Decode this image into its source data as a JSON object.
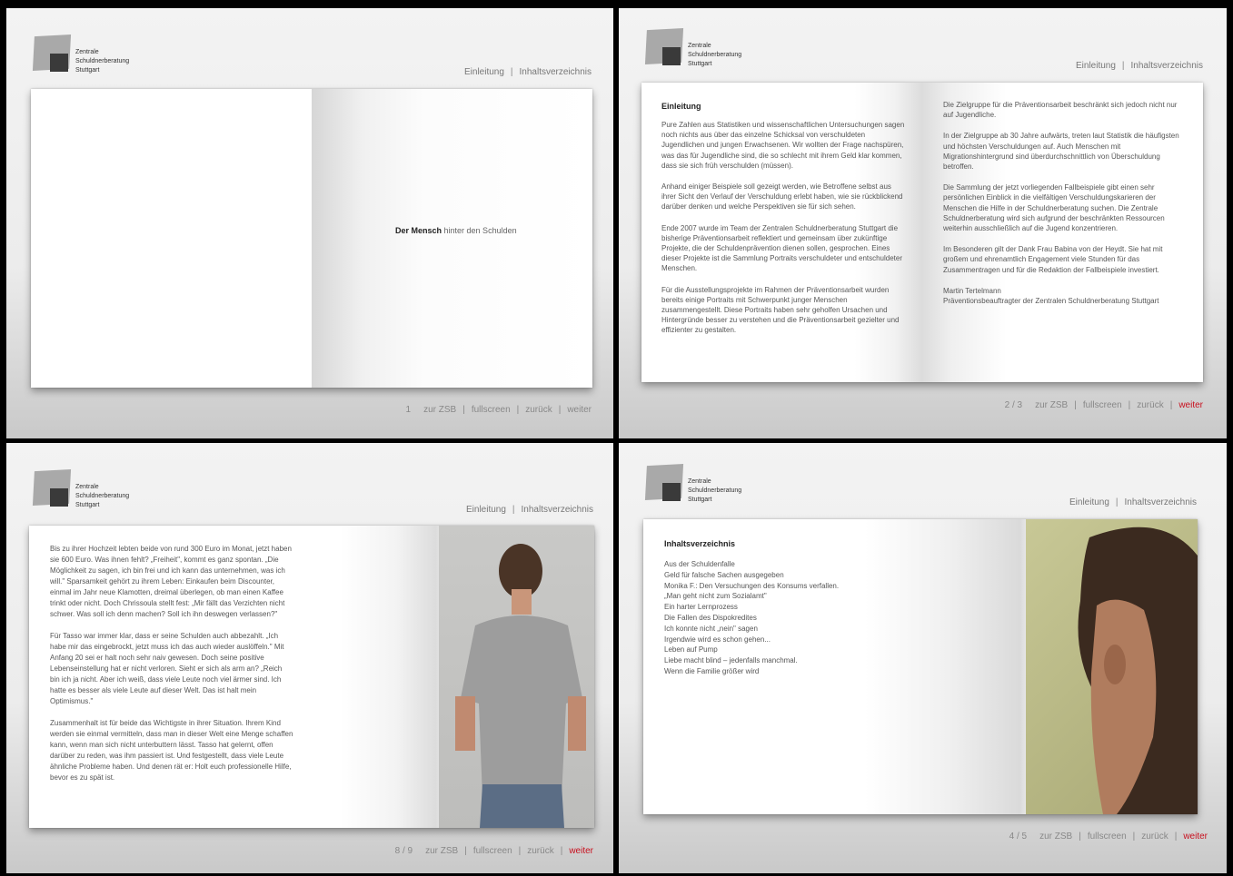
{
  "logo": {
    "text": "Zentrale\nSchuldnerberatung\nStuttgart"
  },
  "nav": {
    "intro": "Einleitung",
    "toc": "Inhaltsverzeichnis",
    "zsb": "zur ZSB",
    "fullscreen": "fullscreen",
    "back": "zurück",
    "next": "weiter"
  },
  "accent_color": "#c8101e",
  "panel1": {
    "page": "1",
    "title_bold": "Der Mensch",
    "title_rest": " hinter den Schulden"
  },
  "panel2": {
    "page": "2 / 3",
    "heading": "Einleitung",
    "left_paragraphs": [
      "Pure Zahlen aus Statistiken und wissenschaftlichen Untersuchungen sagen noch nichts aus über das einzelne Schicksal von verschuldeten Jugendlichen und jungen Erwachsenen. Wir wollten der Frage nachspüren, was das für Jugendliche sind, die so schlecht mit ihrem Geld klar kommen, dass sie sich früh verschulden (müssen).",
      "Anhand einiger Beispiele soll gezeigt werden, wie Betroffene selbst aus ihrer Sicht den Verlauf der Verschuldung erlebt haben, wie sie rückblickend darüber denken und welche Perspektiven sie für sich sehen.",
      "Ende 2007 wurde im Team der Zentralen Schuldnerberatung Stuttgart die bisherige Präventionsarbeit reflektiert und gemeinsam über zukünftige Projekte, die der Schuldenprävention dienen sollen, gesprochen. Eines dieser Projekte ist die Sammlung Portraits verschuldeter und entschuldeter Menschen.",
      "Für die Ausstellungsprojekte im Rahmen der Präventionsarbeit wurden bereits einige Portraits mit Schwerpunkt junger Menschen zusammengestellt. Diese Portraits haben sehr geholfen Ursachen und Hintergründe besser zu verstehen und die Präventionsarbeit gezielter und effizienter zu gestalten."
    ],
    "right_paragraphs": [
      "Die Zielgruppe für die Präventionsarbeit beschränkt sich jedoch nicht nur auf Jugendliche.",
      "In der Zielgruppe ab 30 Jahre aufwärts, treten laut Statistik die häufigsten und höchsten Verschuldungen auf. Auch Menschen mit Migrationshintergrund sind überdurchschnittlich von Überschuldung betroffen.",
      "Die Sammlung der jetzt vorliegenden Fallbeispiele gibt einen sehr persönlichen Einblick in die vielfältigen Verschuldungskarieren der Menschen die Hilfe in der Schuldnerberatung suchen. Die Zentrale Schuldnerberatung wird sich aufgrund der beschränkten Ressourcen weiterhin ausschließlich auf die Jugend konzentrieren.",
      "Im Besonderen gilt der Dank Frau Babina von der Heydt. Sie hat mit großem und ehrenamtlich Engagement viele Stunden für das Zusammentragen und für die Redaktion der Fallbeispiele investiert."
    ],
    "signature_name": "Martin Tertelmann",
    "signature_role": "Präventionsbeauftragter der Zentralen Schuldnerberatung Stuttgart"
  },
  "panel3": {
    "page": "8 / 9",
    "paragraphs": [
      "Bis zu ihrer Hochzeit lebten beide von rund 300 Euro im Monat, jetzt haben sie 600 Euro. Was ihnen fehlt? „Freiheit\", kommt es ganz spontan. „Die Möglichkeit zu sagen, ich bin frei und ich kann das unternehmen, was ich will.\" Sparsamkeit gehört zu ihrem Leben: Einkaufen beim Discounter, einmal im Jahr neue Klamotten, dreimal überlegen, ob man einen Kaffee trinkt oder nicht. Doch Chrissoula stellt fest: „Mir fällt das Verzichten nicht schwer. Was soll ich denn machen? Soll ich ihn deswegen verlassen?\"",
      "Für Tasso war immer klar, dass er seine Schulden auch abbezahlt. „Ich habe mir das eingebrockt, jetzt muss ich das auch wieder auslöffeln.\" Mit Anfang 20 sei er halt noch sehr naiv gewesen. Doch seine positive Lebenseinstellung hat er nicht verloren. Sieht er sich als arm an? „Reich bin ich ja nicht. Aber ich weiß, dass viele Leute noch viel ärmer sind. Ich hatte es besser als viele Leute auf dieser Welt. Das ist halt mein Optimismus.\"",
      "Zusammenhalt ist für beide das Wichtigste in ihrer Situation. Ihrem Kind werden sie einmal vermitteln, dass man in dieser Welt eine Menge schaffen kann, wenn man sich nicht unterbuttern lässt. Tasso hat gelernt, offen darüber zu reden, was ihm passiert ist. Und festgestellt, dass viele Leute ähnliche Probleme haben. Und denen rät er: Holt euch professionelle Hilfe, bevor es zu spät ist."
    ]
  },
  "panel4": {
    "page": "4 / 5",
    "heading": "Inhaltsverzeichnis",
    "items": [
      "Aus der Schuldenfalle",
      "Geld für falsche Sachen ausgegeben",
      "Monika F.: Den Versuchungen des Konsums verfallen.",
      "„Man geht nicht zum Sozialamt\"",
      "Ein harter Lernprozess",
      "Die Fallen des Dispokredites",
      "Ich konnte nicht „nein\" sagen",
      "Irgendwie wird es schon gehen...",
      "Leben auf Pump",
      "Liebe macht blind – jedenfalls manchmal.",
      "Wenn die Familie größer wird"
    ]
  }
}
